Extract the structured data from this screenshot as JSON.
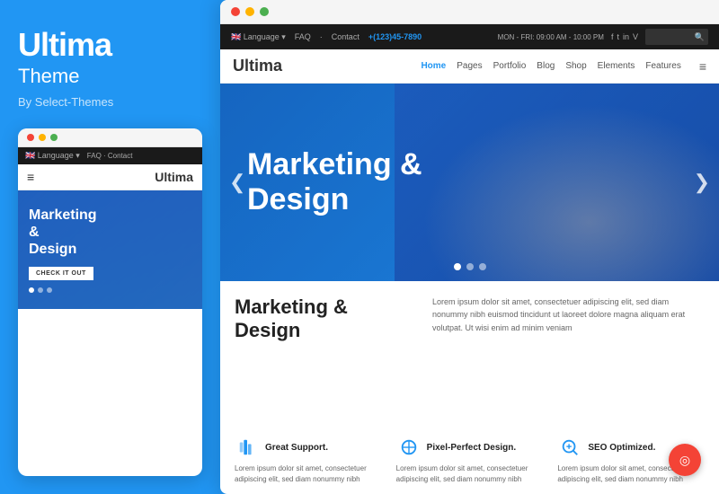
{
  "left": {
    "brand_title": "Ultima",
    "brand_subtitle": "Theme",
    "brand_author": "By Select-Themes",
    "mobile_dots": [
      "dot1",
      "dot2",
      "dot3"
    ],
    "mobile_topbar": {
      "flag": "🇬🇧 Language ▾",
      "links": "FAQ · Contact"
    },
    "mobile_nav": {
      "hamburger": "≡",
      "logo": "Ultima"
    },
    "mobile_hero": {
      "title": "Marketing &\nDesign",
      "button": "CHECK IT OUT"
    },
    "mobile_hero_dots": [
      "active",
      "",
      ""
    ]
  },
  "right": {
    "desktop_topbar": {
      "flag": "🇬🇧 Language ▾",
      "faq": "FAQ",
      "separator": "·",
      "contact": "Contact",
      "phone": "+(123)45-7890",
      "hours": "MON - FRI: 09:00 AM - 10:00 PM",
      "social": [
        "f",
        "t",
        "in",
        "V"
      ]
    },
    "nav": {
      "logo": "Ultima",
      "links": [
        "Home",
        "Pages",
        "Portfolio",
        "Blog",
        "Shop",
        "Elements",
        "Features"
      ],
      "active": "Home",
      "hamburger": "≡"
    },
    "hero": {
      "title": "Marketing &\nDesign",
      "arrow_left": "❮",
      "arrow_right": "❯",
      "dots": [
        "active",
        "",
        ""
      ]
    },
    "content": {
      "main_title": "Marketing &\nDesign",
      "description": "Lorem ipsum dolor sit amet, consectetuer adipiscing elit, sed diam nonummy nibh euismod tincidunt ut laoreet dolore magna aliquam erat volutpat. Ut wisi enim ad minim veniam"
    },
    "features": [
      {
        "icon": "support",
        "title": "Great Support.",
        "desc": "Lorem ipsum dolor sit amet, consectetuer adipiscing elit, sed diam nonummy nibh"
      },
      {
        "icon": "design",
        "title": "Pixel-Perfect Design.",
        "desc": "Lorem ipsum dolor sit amet, consectetuer adipiscing elit, sed diam nonummy nibh"
      },
      {
        "icon": "seo",
        "title": "SEO Optimized.",
        "desc": "Lorem ipsum dolor sit amet, consectetuer adipiscing elit, sed diam nonummy nibh"
      }
    ]
  },
  "fab": {
    "icon": "◎"
  }
}
